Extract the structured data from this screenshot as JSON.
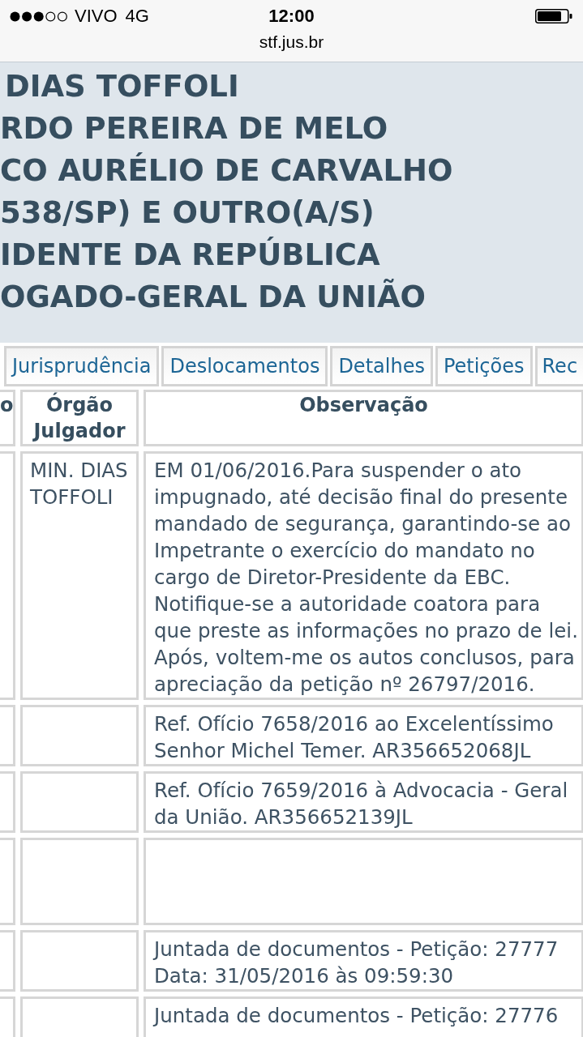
{
  "status_bar": {
    "carrier": "VIVO",
    "network": "4G",
    "time": "12:00"
  },
  "address_bar": {
    "url": "stf.jus.br"
  },
  "header": {
    "lines": [
      "DIAS TOFFOLI",
      "RDO PEREIRA DE MELO",
      "CO AURÉLIO DE CARVALHO",
      "538/SP) E OUTRO(A/S)",
      "IDENTE DA REPÚBLICA",
      "OGADO-GERAL DA UNIÃO"
    ]
  },
  "tabs": [
    {
      "label": "Jurisprudência",
      "selected": false
    },
    {
      "label": "Deslocamentos",
      "selected": false
    },
    {
      "label": "Detalhes",
      "selected": false
    },
    {
      "label": "Petições",
      "selected": false
    },
    {
      "label": "Rec",
      "selected": false
    }
  ],
  "table": {
    "columns": [
      "o",
      "Órgão Julgador",
      "Observação"
    ],
    "rows": [
      {
        "orgao_julgador": "MIN. DIAS TOFFOLI",
        "observacao": "EM 01/06/2016.Para suspender o ato impugnado, até decisão final do presente mandado de segurança, garantindo-se ao Impetrante o exercício do mandato no cargo de Diretor-Presidente da EBC. Notifique-se a autoridade coatora para que preste as informações no prazo de lei. Após, voltem-me os autos conclusos, para apreciação da petição nº 26797/2016."
      },
      {
        "observacao": "Ref. Ofício 7658/2016 ao Excelentíssimo Senhor Michel Temer. AR356652068JL"
      },
      {
        "observacao": "Ref. Ofício 7659/2016 à Advocacia - Geral da União. AR356652139JL"
      },
      {},
      {
        "observacao": "Juntada de documentos - Petição: 27777 Data: 31/05/2016 às 09:59:30"
      },
      {
        "observacao": "Juntada de documentos - Petição: 27776"
      }
    ]
  }
}
